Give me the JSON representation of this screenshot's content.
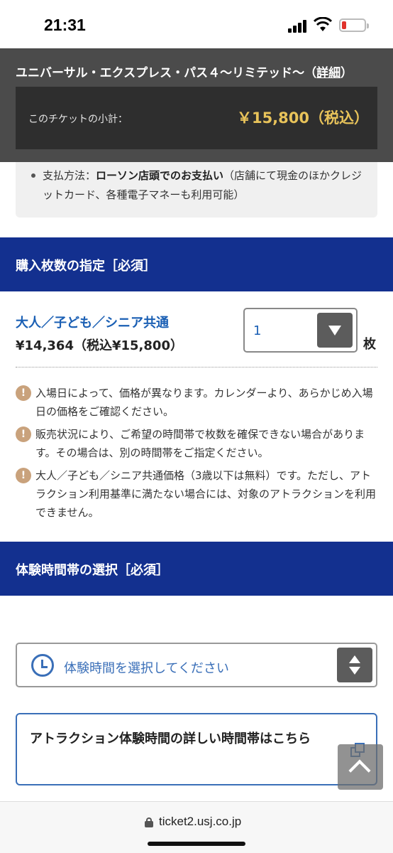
{
  "status_bar": {
    "time": "21:31"
  },
  "ticket_header": {
    "title": "ユニバーサル・エクスプレス・パス４〜リミテッド〜（",
    "detail_link": "詳細",
    "close_paren": "）",
    "subtotal_label": "このチケットの小計：",
    "subtotal_value": "￥15,800（税込）"
  },
  "payment": {
    "label": "支払方法：",
    "method": "ローソン店頭でのお支払い",
    "note": "（店舗にて現金のほかクレジットカード、各種電子マネーも利用可能）"
  },
  "quantity_section": {
    "header": "購入枚数の指定［必須］",
    "ticket_type": "大人／子ども／シニア共通",
    "ticket_price": "¥14,364（税込¥15,800）",
    "selected_quantity": "1",
    "unit": "枚"
  },
  "notices": [
    {
      "icon": "!",
      "text": "入場日によって、価格が異なります。カレンダーより、あらかじめ入場日の価格をご確認ください。"
    },
    {
      "icon": "!",
      "text": "販売状況により、ご希望の時間帯で枚数を確保できない場合があります。その場合は、別の時間帯をご指定ください。"
    },
    {
      "icon": "!",
      "text": "大人／子ども／シニア共通価格（3歳以下は無料）です。ただし、アトラクション利用基準に満たない場合には、対象のアトラクションを利用できません。"
    }
  ],
  "time_section": {
    "header": "体験時間帯の選択［必須］",
    "placeholder": "体験時間を選択してください",
    "attraction_link": "アトラクション体験時間の詳しい時間帯はこちら"
  },
  "browser": {
    "url": "ticket2.usj.co.jp"
  },
  "colors": {
    "section_header": "#13308f",
    "accent_blue": "#1a5fb4",
    "price_gold": "#e8c35a"
  }
}
